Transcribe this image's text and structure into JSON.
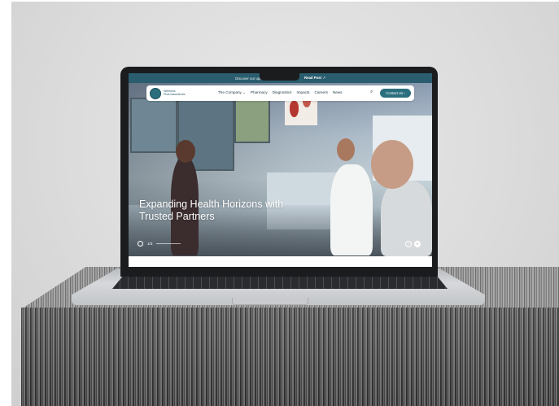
{
  "announcement": {
    "text": "Discover our upcoming ... together!",
    "link": "Read Post",
    "link_icon": "arrow-up-right-icon"
  },
  "brand": {
    "logo_text_line1": "Wellness",
    "logo_text_line2": "Pharmaceuticals",
    "accent": "#2b6f7f"
  },
  "nav": {
    "items": [
      "The Company",
      "Pharmacy",
      "Diagnostics",
      "Impacts",
      "Careers",
      "News"
    ],
    "dropdown_icon": "chevron-down-icon",
    "search_icon": "search-icon",
    "contact_label": "Contact Us",
    "contact_icon": "arrow-right-icon"
  },
  "hero": {
    "headline_line1": "Expanding Health Horizons with",
    "headline_line2": "Trusted Partners",
    "slide_counter": "1/3",
    "prev_icon": "chevron-left-icon",
    "next_icon": "chevron-right-icon"
  }
}
